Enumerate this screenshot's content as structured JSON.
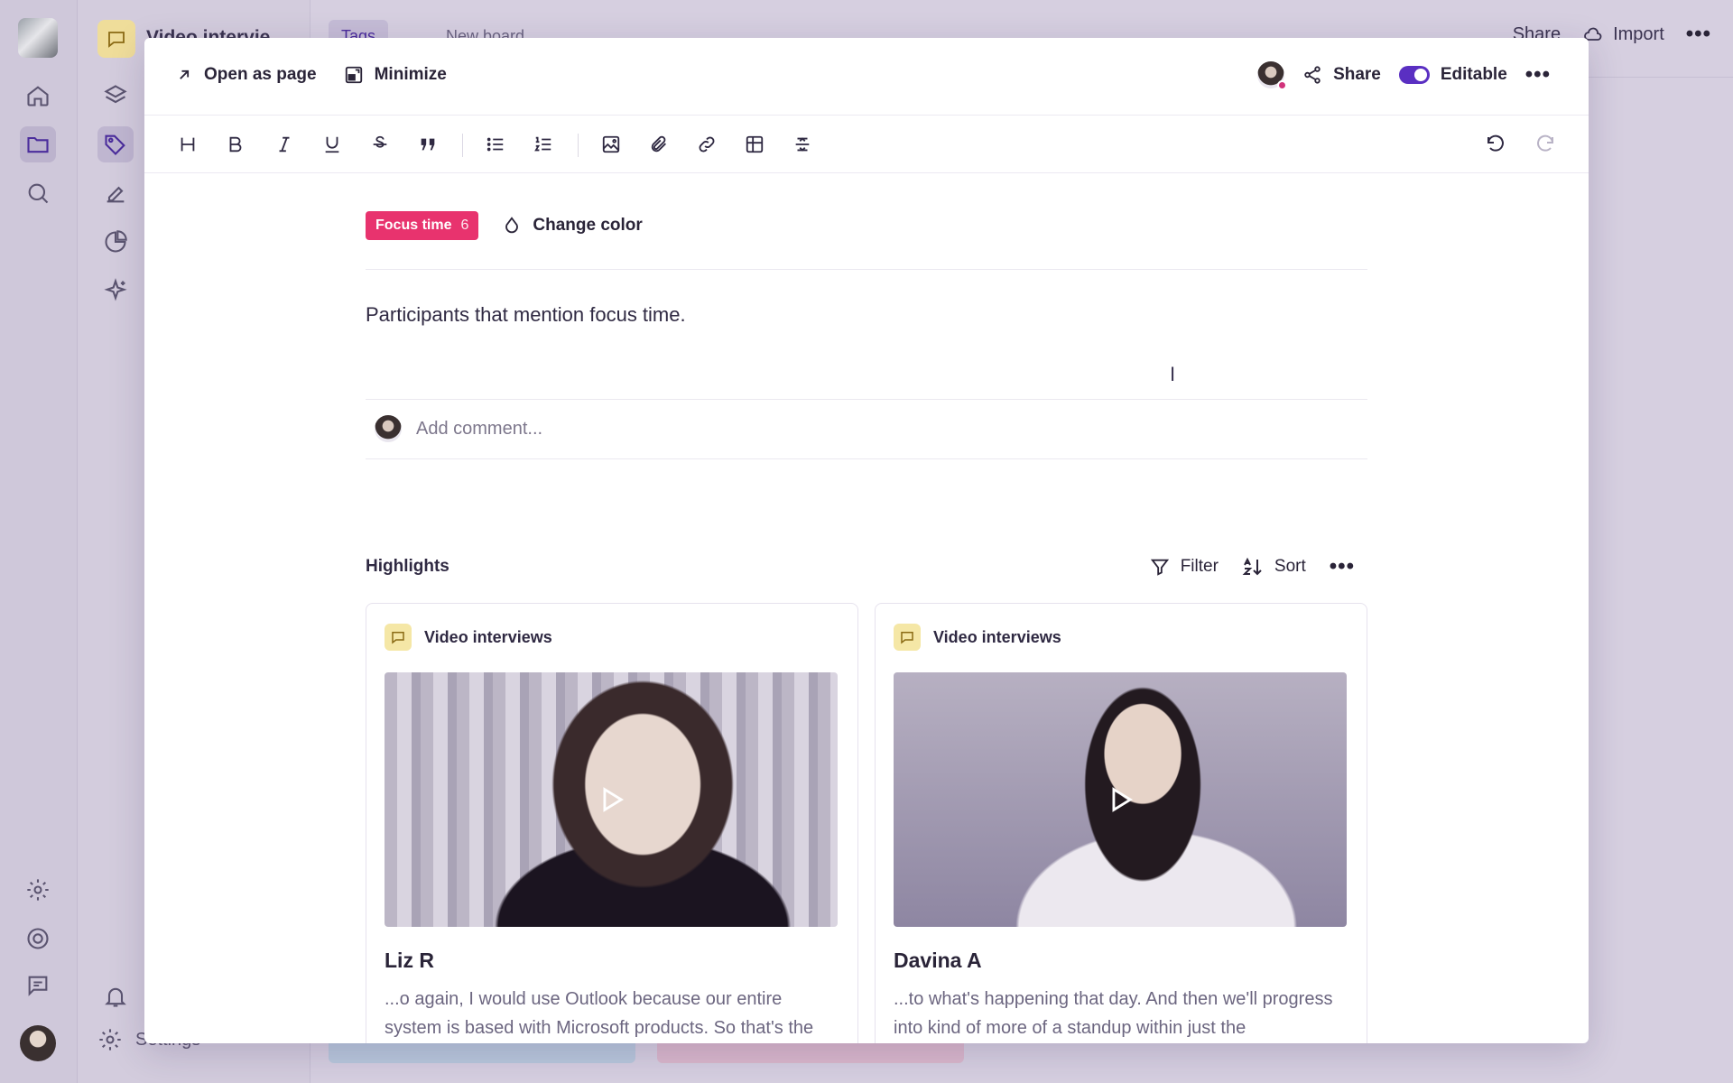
{
  "app": {
    "project_title": "Video intervie",
    "tab_label": "Tags",
    "new_board_label": "New board",
    "share_label": "Share",
    "import_label": "Import",
    "settings_label": "Settings"
  },
  "modal": {
    "open_as_page": "Open as page",
    "minimize": "Minimize",
    "share": "Share",
    "editable": "Editable"
  },
  "tag": {
    "name": "Focus time",
    "count": "6",
    "color": "#e8336e",
    "change_color": "Change color"
  },
  "description": "Participants that mention focus time.",
  "comment": {
    "placeholder": "Add comment..."
  },
  "highlights": {
    "title": "Highlights",
    "filter": "Filter",
    "sort": "Sort",
    "cards": [
      {
        "source": "Video interviews",
        "name": "Liz R",
        "text": "...o again, I would use Outlook because our entire system is based with Microsoft products. So that's the balance there. But personally, the other things that I can't sort of live without tool-wise is time box"
      },
      {
        "source": "Video interviews",
        "name": "Davina A",
        "text": "...to what's happening that day. And then we'll progress into kind of more of a standup within just the development team and making sure that everyone has something to work on and that we're"
      }
    ]
  },
  "colors": {
    "accent": "#5a2fc2",
    "tag_pink": "#e8336e"
  }
}
